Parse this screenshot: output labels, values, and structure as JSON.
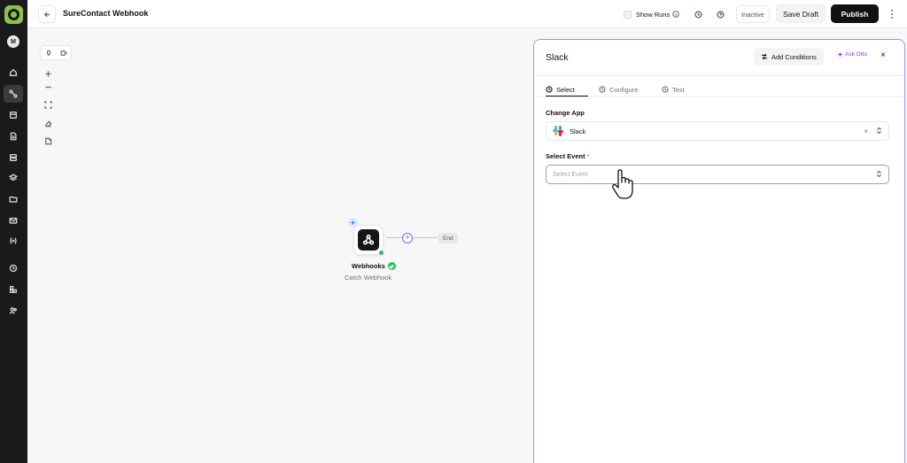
{
  "app": {
    "workflow_title": "SureContact Webhook",
    "avatar_initial": "M"
  },
  "header": {
    "show_runs_label": "Show Runs",
    "status_label": "Inactive",
    "save_draft_label": "Save Draft",
    "publish_label": "Publish"
  },
  "sidebar": {
    "items": [
      {
        "name": "home-icon"
      },
      {
        "name": "workflows-icon",
        "active": true
      },
      {
        "name": "templates-icon"
      },
      {
        "name": "documents-icon"
      },
      {
        "name": "database-icon"
      },
      {
        "name": "layers-icon"
      },
      {
        "name": "folder-icon"
      },
      {
        "name": "mail-icon"
      },
      {
        "name": "variables-icon"
      },
      {
        "name": "history-icon"
      },
      {
        "name": "integrations-icon"
      },
      {
        "name": "users-icon"
      }
    ]
  },
  "canvas": {
    "node": {
      "title": "Webhooks",
      "subtitle": "Catch Webhook",
      "status_color": "#22c55e"
    },
    "end_label": "End"
  },
  "panel": {
    "title": "Slack",
    "add_conditions_label": "Add Conditions",
    "ask_otto_label": "Ask Otto",
    "close_symbol": "×",
    "tabs": [
      {
        "label": "Select",
        "active": true
      },
      {
        "label": "Configure",
        "active": false
      },
      {
        "label": "Test",
        "active": false
      }
    ],
    "change_app_label": "Change App",
    "change_app_value": "Slack",
    "select_event_label": "Select Event",
    "required_marker": "*",
    "select_event_placeholder": "Select Event",
    "clear_symbol": "×"
  },
  "colors": {
    "accent": "#a78bfa",
    "plus": "#8b5cf6",
    "success": "#22c55e",
    "otto": "#9333ea",
    "sidebar_bg": "#1a1a1a",
    "logo": "#8bc34a"
  }
}
